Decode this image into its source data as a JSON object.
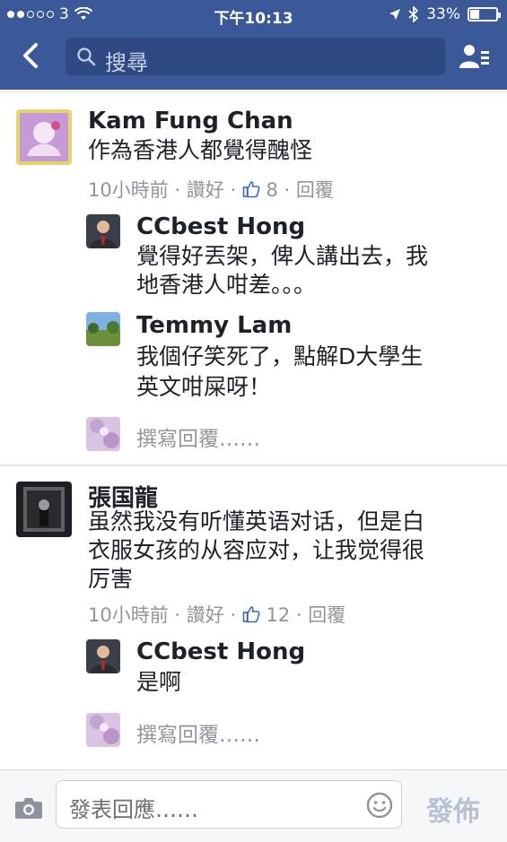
{
  "status": {
    "carrier": "3",
    "time": "下午10:13",
    "battery": "33%",
    "icons": [
      "signal-dots-icon",
      "wifi-icon",
      "location-arrow-icon",
      "bluetooth-icon",
      "battery-icon"
    ]
  },
  "nav": {
    "back_icon": "chevron-left-icon",
    "search_placeholder": "搜尋",
    "friends_icon": "friend-requests-icon"
  },
  "threads": [
    {
      "author": "Kam Fung Chan",
      "text": "作為香港人都覺得醜怪",
      "meta": {
        "time": "10小時前",
        "like": "讚好",
        "count": "8",
        "reply": "回覆"
      },
      "replies": [
        {
          "author": "CCbest Hong",
          "lines": [
            "覺得好丟架，俾人講出去，我",
            "地香港人咁差。。。"
          ]
        },
        {
          "author": "Temmy Lam",
          "lines": [
            "我個仔笑死了，點解D大學生",
            "英文咁屎呀！"
          ]
        }
      ],
      "write_reply": "撰寫回覆……"
    },
    {
      "author": "張国龍",
      "lines": [
        "虽然我没有听懂英语对话，但是白",
        "衣服女孩的从容应对，让我觉得很",
        "厉害"
      ],
      "meta": {
        "time": "10小時前",
        "like": "讚好",
        "count": "12",
        "reply": "回覆"
      },
      "replies": [
        {
          "author": "CCbest Hong",
          "lines": [
            "是啊"
          ]
        }
      ],
      "write_reply": "撰寫回覆……"
    }
  ],
  "composer": {
    "placeholder": "發表回應……",
    "post_label": "發佈"
  },
  "colors": {
    "nav_blue": "#3b5998",
    "meta_gray": "#90949c",
    "like_blue": "#4267b2"
  }
}
